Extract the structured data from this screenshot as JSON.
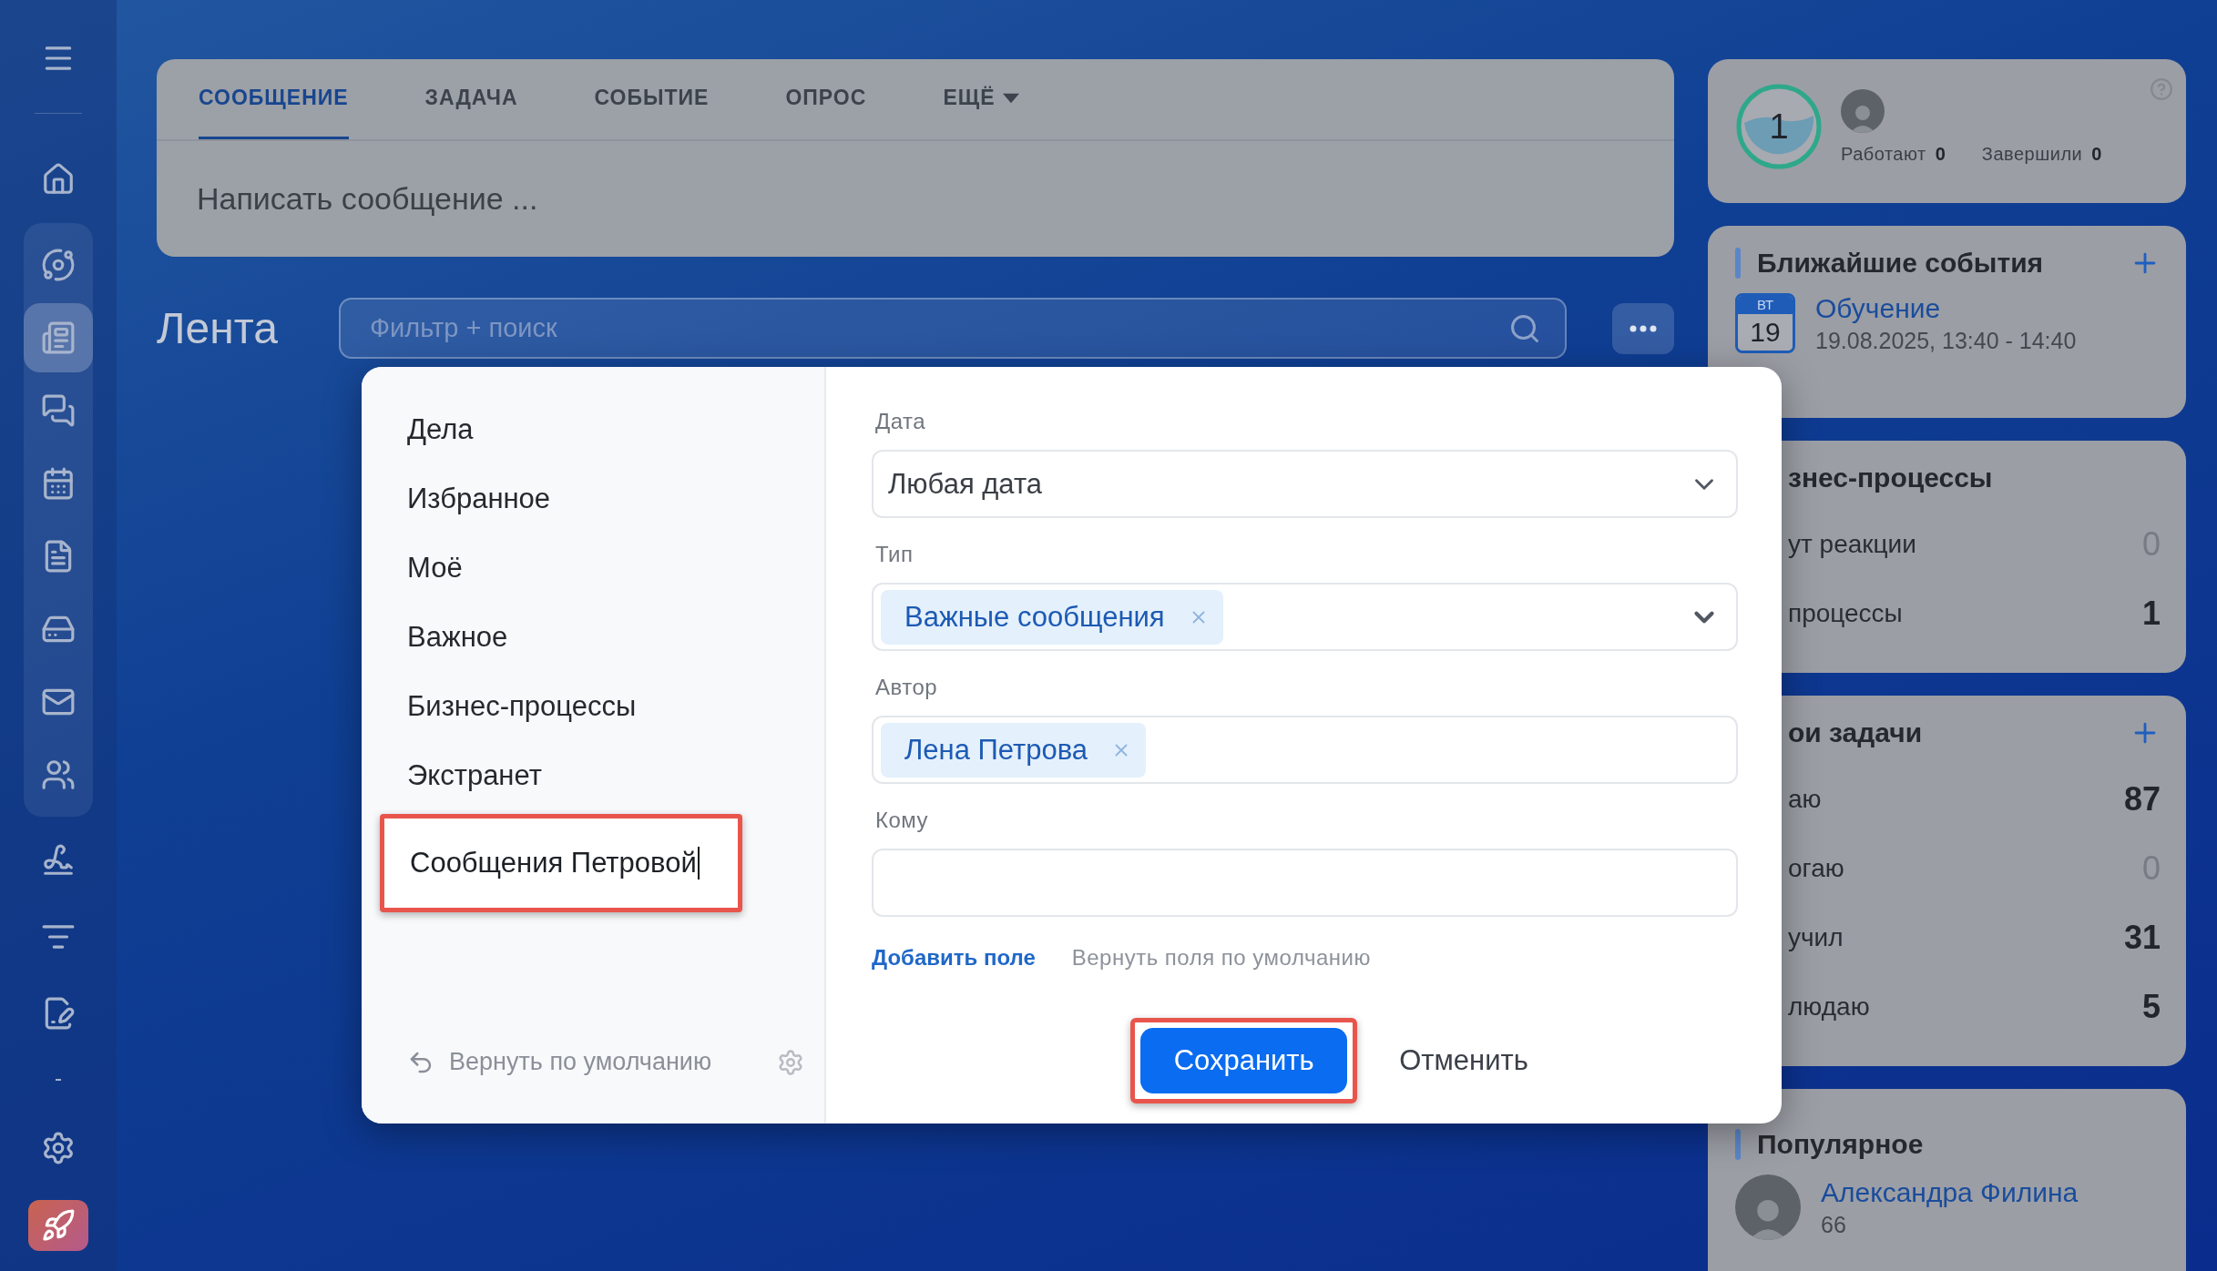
{
  "sidebar": {
    "top": [
      {
        "selected": false
      },
      {
        "selected": false
      }
    ],
    "group": [
      {
        "selected": false
      },
      {
        "selected": true
      },
      {
        "selected": false
      },
      {
        "selected": false
      },
      {
        "selected": false
      },
      {
        "selected": false
      },
      {
        "selected": false
      },
      {
        "selected": false
      }
    ],
    "bottom": [
      {
        "selected": false
      },
      {
        "selected": false
      },
      {
        "selected": false
      },
      {
        "selected": false
      },
      {
        "selected": false
      }
    ]
  },
  "post_form": {
    "tabs": [
      {
        "label": "СООБЩЕНИЕ",
        "selected": true,
        "kind": "tab"
      },
      {
        "label": "ЗАДАЧА",
        "selected": false,
        "kind": "tab"
      },
      {
        "label": "СОБЫТИЕ",
        "selected": false,
        "kind": "tab"
      },
      {
        "label": "ОПРОС",
        "selected": false,
        "kind": "tab"
      },
      {
        "label": "ЕЩЁ",
        "selected": false,
        "kind": "menu"
      }
    ],
    "placeholder": "Написать сообщение ..."
  },
  "feed": {
    "title": "Лента",
    "search": {
      "placeholder": "Фильтр + поиск"
    }
  },
  "filter_dialog": {
    "presets": [
      {
        "label": "Дела",
        "kind": "item",
        "highlighted": false
      },
      {
        "label": "Избранное",
        "kind": "item",
        "highlighted": false
      },
      {
        "label": "Моё",
        "kind": "item",
        "highlighted": false
      },
      {
        "label": "Важное",
        "kind": "item",
        "highlighted": false
      },
      {
        "label": "Бизнес-процессы",
        "kind": "item",
        "highlighted": false
      },
      {
        "label": "Экстранет",
        "kind": "item",
        "highlighted": false
      },
      {
        "label": "Сообщения Петровой",
        "kind": "input",
        "highlighted": true
      }
    ],
    "reset": "Вернуть по умолчанию",
    "fields": [
      {
        "label": "Дата",
        "kind": "select",
        "value": "Любая дата"
      },
      {
        "label": "Тип",
        "kind": "tags",
        "tags": [
          "Важные сообщения"
        ],
        "dropdown": true
      },
      {
        "label": "Автор",
        "kind": "tags",
        "tags": [
          "Лена Петрова"
        ],
        "dropdown": false
      },
      {
        "label": "Кому",
        "kind": "text"
      }
    ],
    "add_field": "Добавить поле",
    "restore_fields": "Вернуть поля по умолчанию",
    "save": {
      "label": "Сохранить",
      "highlighted": true
    },
    "cancel": {
      "label": "Отменить"
    }
  },
  "right": {
    "stats": {
      "counter": "1",
      "items": [
        {
          "label": "Работают",
          "value": "0"
        },
        {
          "label": "Завершили",
          "value": "0"
        }
      ]
    },
    "events": {
      "title": "Ближайшие события",
      "items": [
        {
          "weekday": "ВТ",
          "day": "19",
          "title": "Обучение",
          "time": "19.08.2025, 13:40 - 14:40"
        }
      ]
    },
    "processes": {
      "title": "знес-процессы",
      "rows": [
        {
          "label": "ут реакции",
          "count": "0",
          "muted": true
        },
        {
          "label": "процессы",
          "count": "1",
          "muted": false
        }
      ]
    },
    "tasks": {
      "title": "ои задачи",
      "rows": [
        {
          "label": "аю",
          "count": "87",
          "muted": false
        },
        {
          "label": "огаю",
          "count": "0",
          "muted": true
        },
        {
          "label": "учил",
          "count": "31",
          "muted": false
        },
        {
          "label": "людаю",
          "count": "5",
          "muted": false
        }
      ]
    },
    "popular": {
      "title": "Популярное",
      "items": [
        {
          "name": "Александра Филина",
          "count": "66"
        }
      ]
    }
  }
}
